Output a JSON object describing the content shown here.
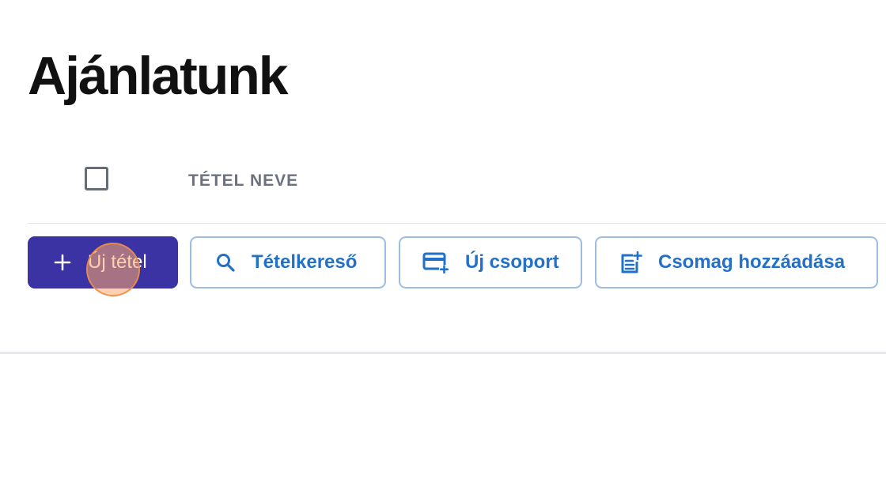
{
  "page": {
    "title": "Ajánlatunk"
  },
  "table": {
    "select_all_checked": false,
    "column_header": "TÉTEL NEVE"
  },
  "toolbar": {
    "new_item_label": "Új tétel",
    "new_item_icon": "plus-icon",
    "search_label": "Tételkereső",
    "search_icon": "search-icon",
    "new_group_label": "Új csoport",
    "new_group_icon": "card-plus-icon",
    "add_package_label": "Csomag hozzáadása",
    "add_package_icon": "document-plus-icon"
  },
  "colors": {
    "primary": "#3b32a3",
    "outline_text": "#2270c7",
    "outline_border": "#9dbde0"
  }
}
